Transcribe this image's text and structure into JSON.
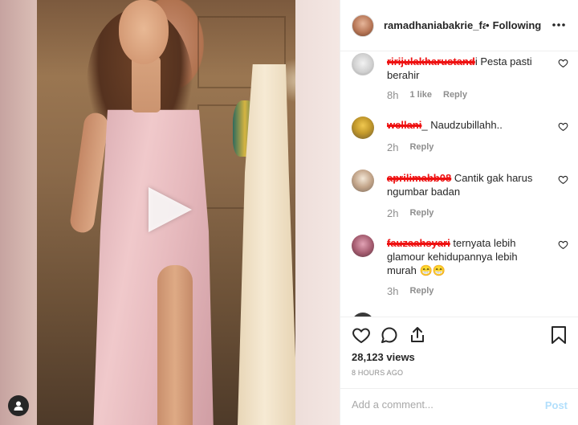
{
  "post": {
    "username": "ramadhaniabakrie_fans",
    "separator": "•",
    "follow_status": "Following"
  },
  "comments": [
    {
      "username": "ririjulakharustand",
      "text": "i Pesta pasti berahir",
      "time": "8h",
      "likes": "1 like",
      "reply": "Reply"
    },
    {
      "username": "wellani",
      "text": "_ Naudzubillahh..",
      "time": "2h",
      "reply": "Reply"
    },
    {
      "username": "aprilimabb08",
      "text": " Cantik gak harus ngumbar badan",
      "time": "2h",
      "reply": "Reply"
    },
    {
      "username": "fauzaahsyari",
      "text": " ternyata lebih glamour kehidupannya lebih murah 😁😁",
      "time": "3h",
      "reply": "Reply"
    }
  ],
  "stats": {
    "views": "28,123 views",
    "time_ago": "8 HOURS AGO"
  },
  "composer": {
    "placeholder": "Add a comment...",
    "post_label": "Post"
  },
  "colors": {
    "text": "#262626",
    "muted": "#8e8e8e",
    "post_disabled": "#b2dffc",
    "redaction": "#e11111"
  },
  "icons": {
    "more": "more-horizontal-icon",
    "like": "heart-icon",
    "comment": "comment-bubble-icon",
    "share": "share-upload-icon",
    "save": "bookmark-icon",
    "play": "play-icon",
    "user_tag": "user-silhouette-icon"
  }
}
